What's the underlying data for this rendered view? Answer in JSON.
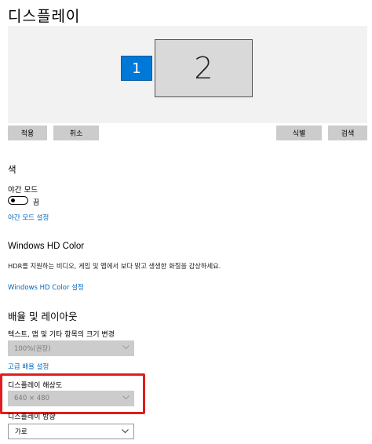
{
  "page": {
    "title": "디스플레이"
  },
  "arrangement": {
    "monitors": [
      {
        "number": "1",
        "selected": true
      },
      {
        "number": "2",
        "selected": false
      }
    ],
    "buttons": {
      "apply": "적용",
      "cancel": "취소",
      "identify": "식별",
      "detect": "검색"
    }
  },
  "color_section": {
    "title": "색",
    "night_light_label": "야간 모드",
    "toggle_state": "끔",
    "toggle_on": false,
    "settings_link": "야간 모드 설정"
  },
  "hd_color": {
    "title": "Windows HD Color",
    "description": "HDR를 지원하는 비디오, 게임 및 앱에서 보다 밝고 생생한 화질을 감상하세요.",
    "settings_link": "Windows HD Color 설정"
  },
  "layout_section": {
    "title": "배율 및 레이아웃",
    "scale_label": "텍스트, 앱 및 기타 항목의 크기 변경",
    "scale_value": "100%(권장)",
    "advanced_link": "고급 배율 설정",
    "resolution_label": "디스플레이 해상도",
    "resolution_value": "640 × 480",
    "orientation_label": "디스플레이 방향",
    "orientation_value": "가로"
  },
  "colors": {
    "accent": "#0078d7",
    "link": "#0067c0",
    "highlight": "#e11d1d",
    "disabled_control": "#cccccc"
  }
}
